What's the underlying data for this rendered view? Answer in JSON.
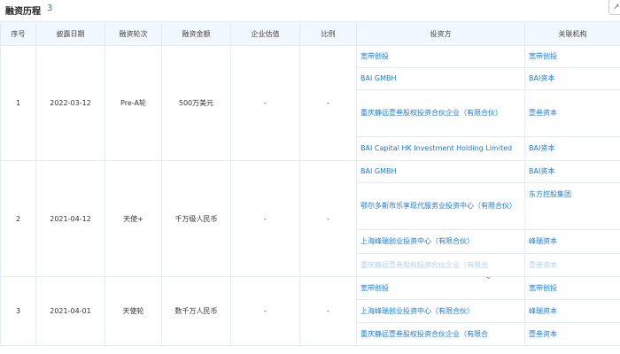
{
  "header": {
    "title": "融资历程",
    "count": "3",
    "btn_icon": "↗"
  },
  "columns": [
    "序号",
    "披露日期",
    "融资轮次",
    "融资金额",
    "企业估值",
    "比例",
    "投资方",
    "关联机构"
  ],
  "rounds": [
    {
      "index": "1",
      "date": "2022-03-12",
      "round": "Pre-A轮",
      "amount": "500万美元",
      "valuation": "-",
      "ratio": "-",
      "investors": [
        {
          "name": "宽带创投",
          "org": "宽带创投"
        },
        {
          "name": "BAI GMBH",
          "org": "BAI资本"
        },
        {
          "name": "重庆静远壹叁股权投资合伙企业（有限合伙）",
          "org": "壹叁资本"
        },
        {
          "name": "BAI Capital HK Investment Holding Limited",
          "org": "BAI资本"
        }
      ]
    },
    {
      "index": "2",
      "date": "2021-04-12",
      "round": "天使+",
      "amount": "千万级人民币",
      "valuation": "-",
      "ratio": "-",
      "investors": [
        {
          "name": "BAI GMBH",
          "org": "BAI资本"
        },
        {
          "name": "鄂尔多斯市乐享现代服务业投资中心（有限合伙）",
          "org": "东方控股集团"
        },
        {
          "name": "上海峰瑞创业投资中心（有限合伙）",
          "org": "峰瑞资本"
        },
        {
          "name": "重庆静远壹叁股权投资合伙企业（有限合",
          "org": "壹叁资本"
        }
      ]
    },
    {
      "index": "3",
      "date": "2021-04-01",
      "round": "天使轮",
      "amount": "数千万人民币",
      "valuation": "-",
      "ratio": "-",
      "investors": [
        {
          "name": "宽带创投",
          "org": "宽带创投"
        },
        {
          "name": "上海峰瑞创业投资中心（有限合伙）",
          "org": "峰瑞资本"
        },
        {
          "name": "重庆静远壹叁股权投资合伙企业（有限合",
          "org": "壹叁资本"
        }
      ]
    }
  ],
  "expand_icon": "⌄"
}
